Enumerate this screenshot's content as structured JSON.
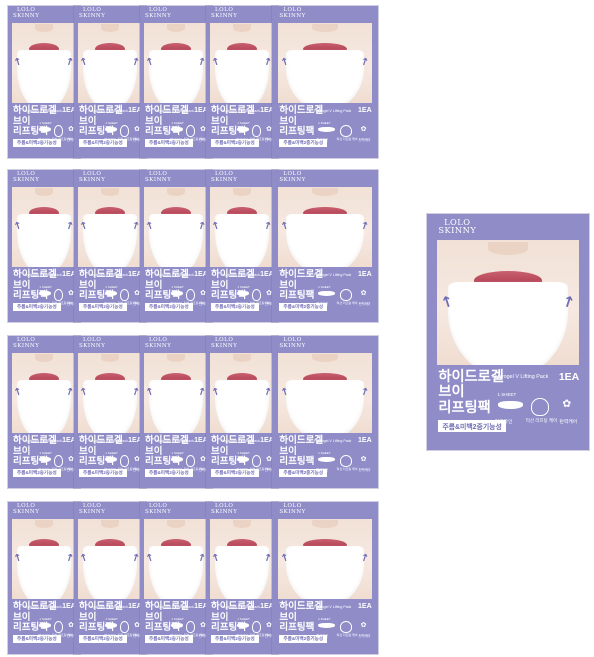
{
  "product": {
    "brand_line1": "LOLO",
    "brand_line2": "SKINNY",
    "title_line1": "하이드로겔",
    "title_line2": "브이",
    "title_line3": "리프팅팩",
    "benefit": "주름&미백2중기능성",
    "english_name": "Hydrogel V Lifting Pack",
    "count": "1EA",
    "sheet_info": "1 SHEET",
    "caption_1": "얼굴라인",
    "caption_2": "턱선 리프팅 케어",
    "caption_3": "탄력케어",
    "icons": {
      "arrow": "lift-arrow-icon",
      "sheet": "sheet-icon",
      "face": "face-outline-icon",
      "care": "care-sparkle-icon"
    }
  },
  "grid": {
    "columns": 5,
    "rows": 4
  },
  "colors": {
    "pack_purple": "#8f8cc8",
    "arrow_purple": "#6f6cb4",
    "lip_red": "#c9606f",
    "skin": "#f1e1d6",
    "mask_white": "#ffffff"
  }
}
